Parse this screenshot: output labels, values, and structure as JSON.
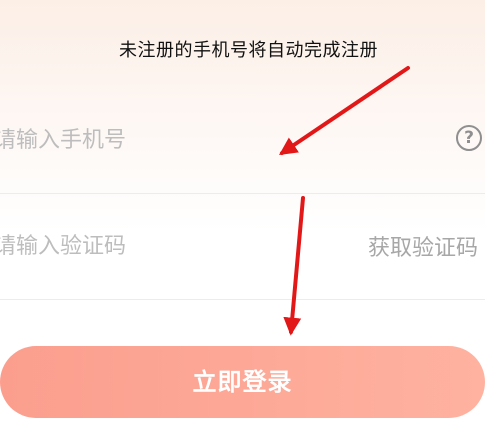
{
  "hint": {
    "text": "未注册的手机号将自动完成注册"
  },
  "phone": {
    "placeholder": "请输入手机号",
    "value": ""
  },
  "help": {
    "icon": "question-circle-icon",
    "glyph": "?"
  },
  "code": {
    "placeholder": "请输入验证码",
    "value": "",
    "get_code_label": "获取验证码"
  },
  "login": {
    "label": "立即登录"
  },
  "colors": {
    "accent": "#fca592",
    "annotation": "#e21818"
  }
}
